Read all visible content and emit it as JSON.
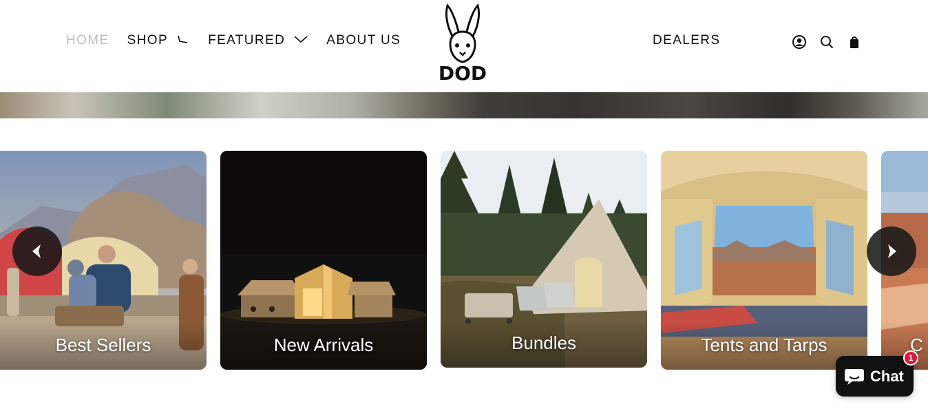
{
  "nav": {
    "home": "HOME",
    "shop": "SHOP",
    "featured": "FEATURED",
    "about": "ABOUT US",
    "dealers": "DEALERS"
  },
  "logo": {
    "text": "DOD"
  },
  "icons": [
    "account-icon",
    "search-icon",
    "cart-icon"
  ],
  "carousel": {
    "cards": [
      {
        "label": "Best Sellers"
      },
      {
        "label": "New Arrivals"
      },
      {
        "label": "Bundles"
      },
      {
        "label": "Tents and Tarps"
      },
      {
        "label": "C"
      }
    ]
  },
  "chat": {
    "label": "Chat",
    "badge": "1"
  },
  "colors": {
    "active_nav": "#bdbdbd",
    "chat_bg": "#111111",
    "badge": "#e3173d"
  }
}
